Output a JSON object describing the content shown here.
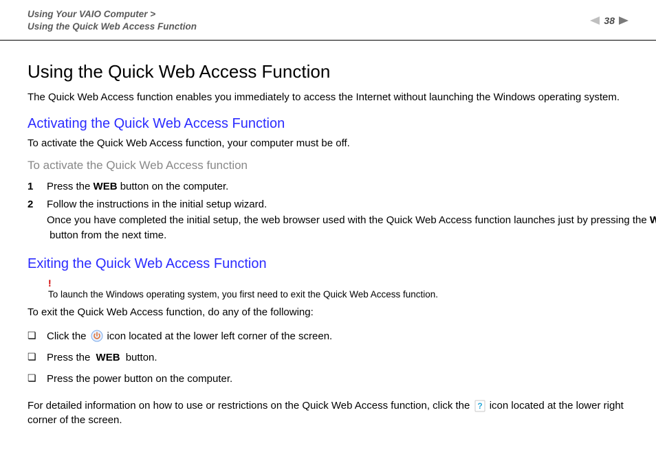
{
  "header": {
    "breadcrumb_line1": "Using Your VAIO Computer >",
    "breadcrumb_line2": "Using the Quick Web Access Function",
    "page_number": "38"
  },
  "main": {
    "title": "Using the Quick Web Access Function",
    "intro": "The Quick Web Access function enables you immediately to access the Internet without launching the Windows operating system.",
    "section1": {
      "heading": "Activating the Quick Web Access Function",
      "text": "To activate the Quick Web Access function, your computer must be off.",
      "subheading": "To activate the Quick Web Access function",
      "steps": [
        {
          "num": "1",
          "pre": "Press the ",
          "bold": "WEB",
          "post": " button on the computer."
        },
        {
          "num": "2",
          "line1": "Follow the instructions in the initial setup wizard.",
          "line2_pre": "Once you have completed the initial setup, the web browser used with the Quick Web Access function launches just by pressing the ",
          "line2_bold": "WEB",
          "line2_post": " button from the next time."
        }
      ]
    },
    "section2": {
      "heading": "Exiting the Quick Web Access Function",
      "note_mark": "!",
      "note": "To launch the Windows operating system, you first need to exit the Quick Web Access function.",
      "intro": "To exit the Quick Web Access function, do any of the following:",
      "bullets": {
        "b1_pre": "Click the ",
        "b1_post": " icon located at the lower left corner of the screen.",
        "b2_pre": "Press the ",
        "b2_bold": "WEB",
        "b2_post": " button.",
        "b3": "Press the power button on the computer."
      },
      "final_pre": "For detailed information on how to use or restrictions on the Quick Web Access function, click the ",
      "final_post": " icon located at the lower right corner of the screen."
    }
  },
  "bullet_glyph": "❏"
}
